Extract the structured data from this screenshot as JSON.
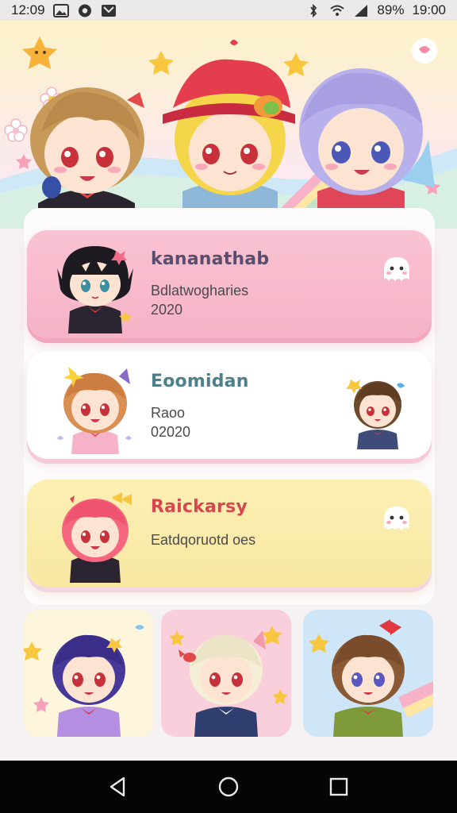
{
  "status_bar": {
    "time_left": "12:09",
    "battery": "89%",
    "time_right": "19:00"
  },
  "cards": [
    {
      "title": "kananathab",
      "line1": "Bdlatwogharies",
      "line2": "2020",
      "accent": "#f7b8ca"
    },
    {
      "title": "Eoomidan",
      "line1": "Raoo",
      "line2": "02020",
      "accent": "#ffffff"
    },
    {
      "title": "Raickarsy",
      "line1": "Eatdqoruotd oes",
      "line2": "",
      "accent": "#faecab"
    }
  ],
  "nav": {
    "back": "back-triangle",
    "home": "home-circle",
    "recents": "recents-square"
  }
}
